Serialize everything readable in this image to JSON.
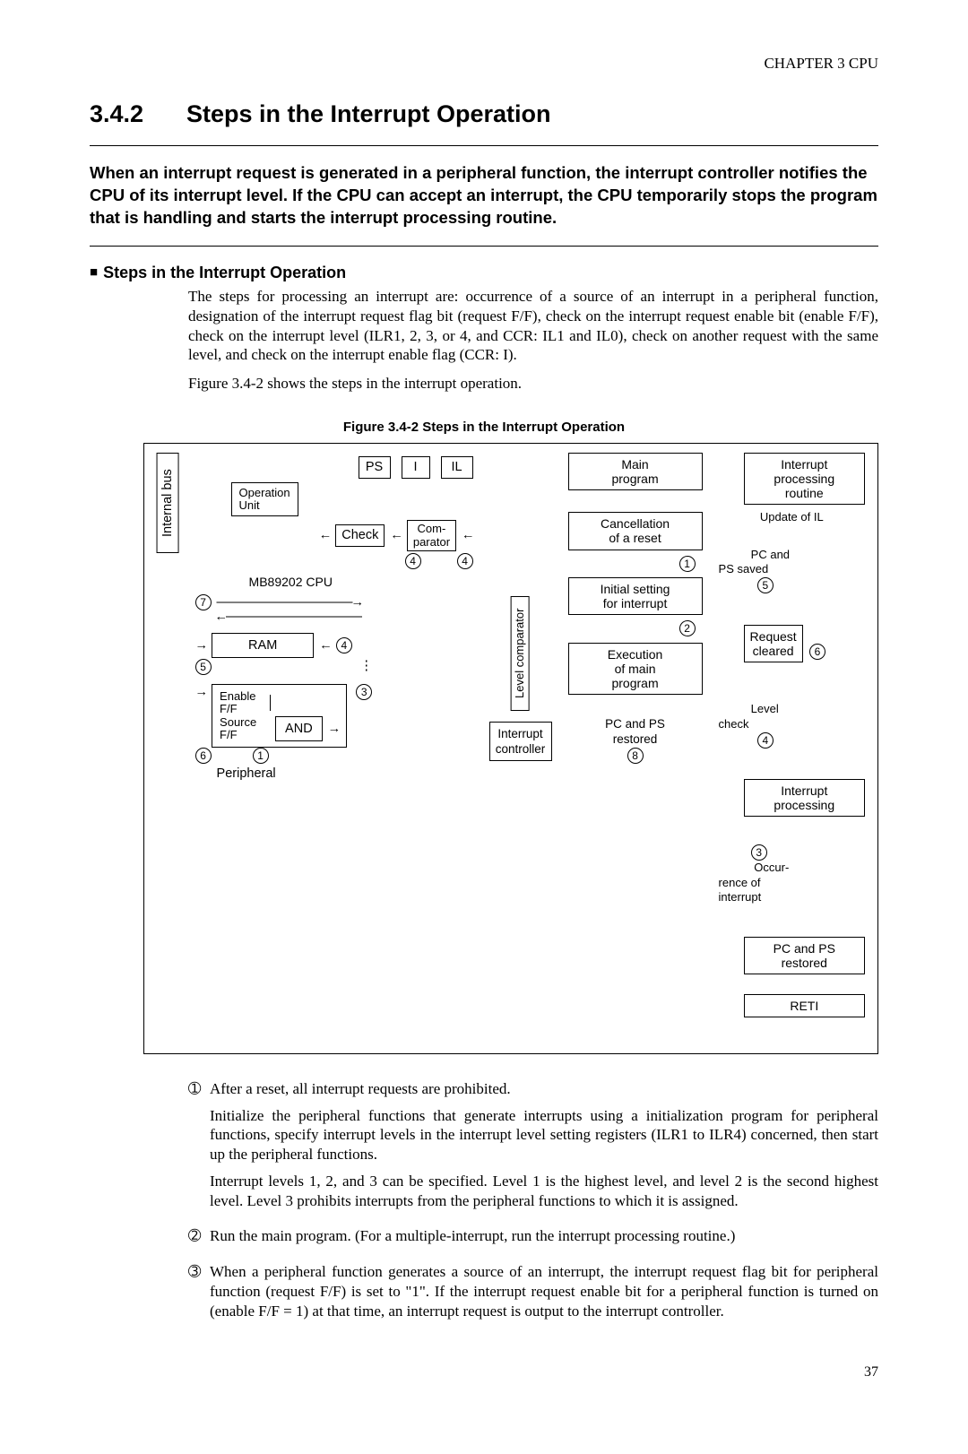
{
  "chapter": "CHAPTER 3  CPU",
  "section_number": "3.4.2",
  "section_title": "Steps in the Interrupt Operation",
  "lead": "When an interrupt request is generated in a peripheral function, the interrupt controller notifies the CPU of its interrupt level. If the CPU can accept an interrupt, the CPU temporarily stops the program that is handling and starts the interrupt processing routine.",
  "subhead_marker": "■",
  "subhead": "Steps in the Interrupt Operation",
  "para1": "The steps for processing an interrupt are: occurrence of a source of an interrupt in a peripheral function, designation of the interrupt request flag bit (request F/F), check on the interrupt request enable bit (enable F/F), check on the interrupt level (ILR1, 2, 3, or 4, and CCR: IL1 and IL0), check on another request with the same level, and check on the interrupt enable flag (CCR: I).",
  "para2": "Figure 3.4-2 shows the steps in the interrupt operation.",
  "figure_caption": "Figure 3.4-2  Steps in the Interrupt Operation",
  "fig": {
    "internal_bus": "Internal bus",
    "operation_unit": "Operation\nUnit",
    "ps": "PS",
    "i": "I",
    "il": "IL",
    "check": "Check",
    "comparator": "Com-\nparator",
    "cpu": "MB89202 CPU",
    "ram": "RAM",
    "enable": "Enable\nF/F",
    "source": "Source\nF/F",
    "and": "AND",
    "peripheral": "Peripheral",
    "level_comparator": "Level comparator",
    "interrupt_controller": "Interrupt\ncontroller",
    "flow": {
      "main": "Main\nprogram",
      "cancel": "Cancellation\nof a reset",
      "initial": "Initial setting\nfor interrupt",
      "exec": "Execution\nof main\nprogram",
      "pcps_bottom": "PC and PS\nrestored"
    },
    "side": {
      "int_routine": "Interrupt\nprocessing\nroutine",
      "update": "Update of IL",
      "pcps_saved": "PC and\nPS saved",
      "req_cleared": "Request\ncleared",
      "level_check": "Level\ncheck",
      "int_processing": "Interrupt\nprocessing",
      "occurrence": "Occur-\nrence of\ninterrupt",
      "pcps_restored": "PC and PS\nrestored",
      "reti": "RETI"
    },
    "nums": {
      "c1": "1",
      "c2": "2",
      "c3": "3",
      "c4": "4",
      "c5": "5",
      "c6": "6",
      "c7": "7",
      "c8": "8"
    }
  },
  "steps": [
    {
      "num": "➀",
      "paras": [
        "After a reset, all interrupt requests are prohibited.",
        "Initialize the peripheral functions that generate interrupts using a initialization program for peripheral functions, specify interrupt levels in the interrupt level setting registers (ILR1 to ILR4) concerned, then start up the peripheral functions.",
        "Interrupt levels 1, 2, and 3 can be specified. Level 1 is the highest level, and level 2 is the second highest level. Level 3 prohibits interrupts from the peripheral functions to which it is assigned."
      ]
    },
    {
      "num": "➁",
      "paras": [
        "Run the main program. (For a multiple-interrupt, run the interrupt processing routine.)"
      ]
    },
    {
      "num": "➂",
      "paras": [
        "When a peripheral function generates a source of an interrupt, the interrupt request flag bit for peripheral function (request F/F) is set to \"1\". If the interrupt request enable bit for a peripheral function is turned on (enable F/F = 1) at that time, an interrupt request is output to the interrupt controller."
      ]
    }
  ],
  "page_number": "37"
}
